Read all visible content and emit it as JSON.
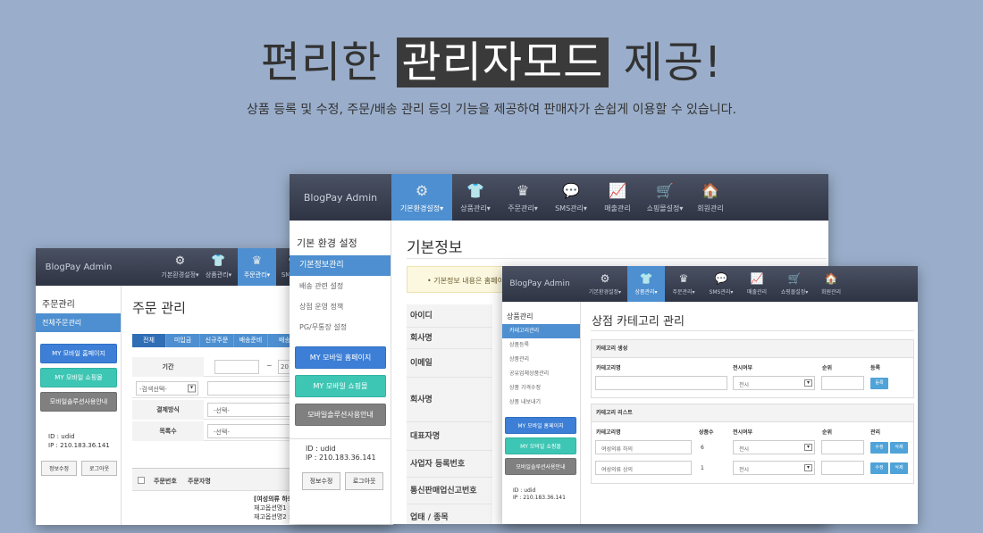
{
  "headline": {
    "before": "편리한 ",
    "highlight": "관리자모드",
    "after": " 제공!"
  },
  "subline": "상품 등록 및 수정, 주문/배송 관리 등의 기능을 제공하여 판매자가 손쉽게 이용할 수 있습니다.",
  "brand": "BlogPay Admin",
  "nav_icons": {
    "settings": "⚙",
    "goods": "👕",
    "order": "♛",
    "sms": "💬",
    "sales": "📈",
    "mall": "🛒",
    "member": "🏠"
  },
  "w1": {
    "nav": [
      "기본환경설정▾",
      "상품관리▾",
      "주문관리▾",
      "SMS관리▾"
    ],
    "side_title": "주문관리",
    "side_active": "전체주문관리",
    "btn_home": "MY 모바일 홈페이지",
    "btn_shop": "MY 모바일 쇼핑몰",
    "btn_guide": "모바일솔루션사용안내",
    "id_line": "ID : udid",
    "ip_line": "IP : 210.183.36.141",
    "btn_edit": "정보수정",
    "btn_logout": "로그아웃",
    "page_title": "주문 관리",
    "tabs": [
      "전체",
      "미입금",
      "신규주문",
      "배송준비",
      "배송"
    ],
    "label_period": "기간",
    "period_sep": "~",
    "period_to": "20",
    "search_select": "-검색선택-",
    "label_pay": "결제방식",
    "pay_select": "-선택-",
    "label_count": "목록수",
    "count_select": "-선택-",
    "col_order_no": "주문번호",
    "col_orderer": "주문자명",
    "col_product": "상",
    "prod_line1": "[여성의류 하의] 테스트 / 1",
    "prod_line2": "재고옵션명1 : 재고옵션명1",
    "prod_line3": "재고옵션명2 : 재고옵션명2"
  },
  "w2": {
    "nav": [
      "기본환경설정▾",
      "상품관리▾",
      "주문관리▾",
      "SMS관리▾",
      "매출관리",
      "쇼핑몰설정▾",
      "회원관리"
    ],
    "side_title": "기본 환경 설정",
    "side_items": [
      "기본정보관리",
      "배송 관련 설정",
      "상점 운영 정책",
      "PG/무통장 설정"
    ],
    "btn_home": "MY 모바일 홈페이지",
    "btn_shop": "MY 모바일 쇼핑몰",
    "btn_guide": "모바일솔루션사용안내",
    "id_line": "ID : udid",
    "ip_line": "IP : 210.183.36.141",
    "btn_edit": "정보수정",
    "btn_logout": "로그아웃",
    "page_title": "기본정보",
    "notice": "•  기본정보 내용은 홈페이",
    "fields": [
      "아이디",
      "회사명",
      "이메일",
      "회사명",
      "대표자명",
      "사업자 등록번호",
      "통신판매업신고번호",
      "업태 / 종목"
    ]
  },
  "w3": {
    "nav": [
      "기본환경설정▾",
      "상품관리▾",
      "주문관리▾",
      "SMS관리▾",
      "매출관리",
      "쇼핑몰설정▾",
      "회원관리"
    ],
    "side_title": "상품관리",
    "side_items": [
      "카테고리관리",
      "상품등록",
      "상품관리",
      "공유업체상품관리",
      "상품 가격수정",
      "상품 내보내기"
    ],
    "btn_home": "MY 모바일 홈페이지",
    "btn_shop": "MY 모바일 쇼핑몰",
    "btn_guide": "모바일솔루션사용안내",
    "id_line": "ID : udid",
    "ip_line": "IP : 210.183.36.141",
    "page_title": "상점 카테고리 관리",
    "create_title": "카테고리 생성",
    "col_name": "카테고리명",
    "col_display": "전시여부",
    "col_order": "순위",
    "col_register": "등록",
    "display_default": "전시",
    "btn_register": "등록",
    "list_title": "카테고리 리스트",
    "col_count": "상품수",
    "col_manage": "관리",
    "btn_edit": "수정",
    "btn_delete": "삭제",
    "rows": [
      {
        "name": "여성의류 하의",
        "count": "6",
        "display": "전시"
      },
      {
        "name": "여성의류 상의",
        "count": "1",
        "display": "전시"
      }
    ]
  }
}
